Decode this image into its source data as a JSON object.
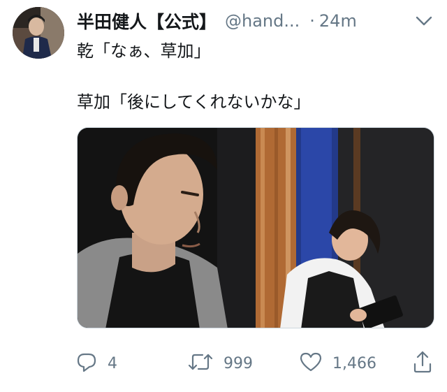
{
  "tweet": {
    "display_name": "半田健人【公式】",
    "handle": "@hand...",
    "separator": "·",
    "timestamp": "24m",
    "text_line_1": "乾「なぁ、草加」",
    "text_line_2": "草加「後にしてくれないかな」",
    "actions": {
      "reply_count": "4",
      "retweet_count": "999",
      "like_count": "1,466"
    }
  },
  "icons": {
    "caret": "chevron-down-icon",
    "reply": "reply-icon",
    "retweet": "retweet-icon",
    "like": "heart-icon",
    "share": "share-icon"
  },
  "colors": {
    "text": "#14171a",
    "secondary": "#657786",
    "border": "#ccd6dd"
  }
}
